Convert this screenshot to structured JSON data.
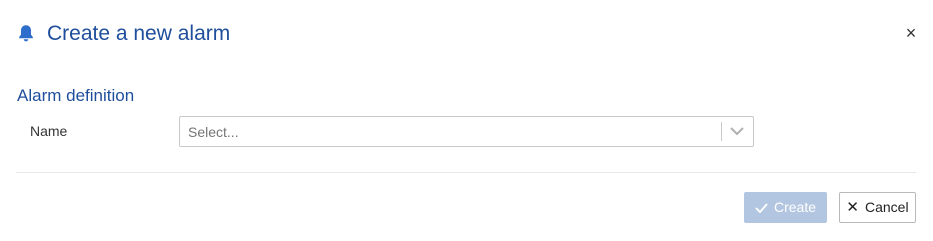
{
  "header": {
    "icon": "bell-icon",
    "title": "Create a new alarm",
    "close_icon": "close-icon",
    "close_glyph": "×"
  },
  "section": {
    "title": "Alarm definition"
  },
  "form": {
    "name_label": "Name",
    "name_select": {
      "placeholder": "Select...",
      "value": "",
      "dropdown_icon": "chevron-down-icon"
    }
  },
  "footer": {
    "create_label": "Create",
    "create_icon": "check-icon",
    "create_disabled": true,
    "cancel_label": "Cancel",
    "cancel_icon": "close-icon",
    "cancel_glyph": "✕"
  },
  "colors": {
    "accent": "#1f4e9c",
    "bell": "#2d6dcc",
    "create_disabled_bg": "#b3c6e1"
  }
}
